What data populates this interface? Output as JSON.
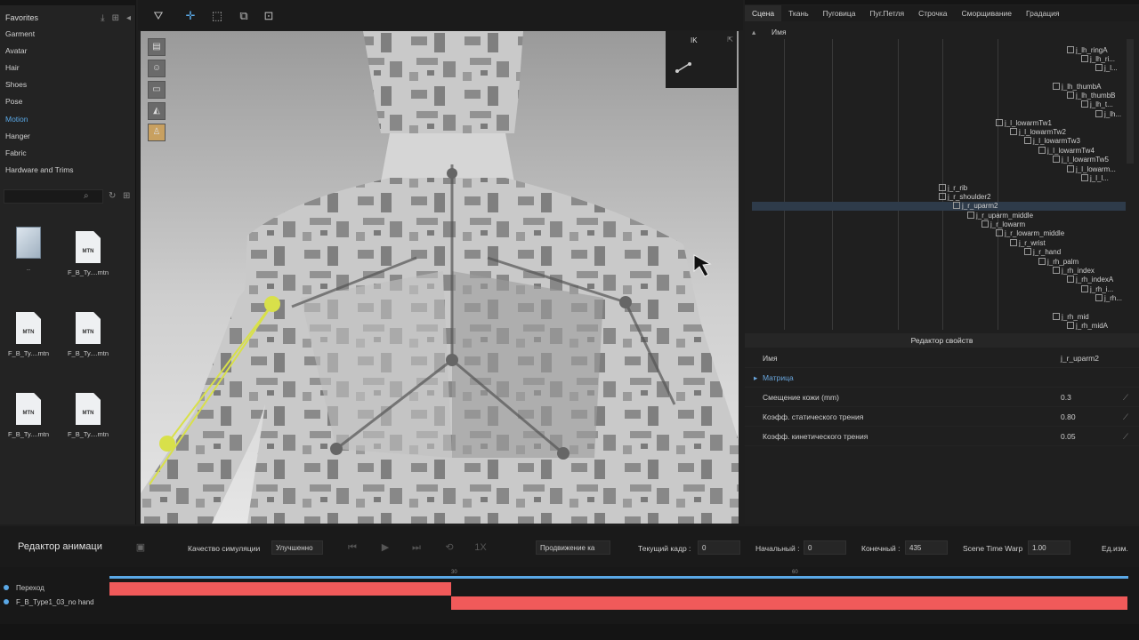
{
  "library": {
    "header": "Favorites",
    "items": [
      "Garment",
      "Avatar",
      "Hair",
      "Shoes",
      "Pose",
      "Motion",
      "Hanger",
      "Fabric",
      "Hardware and Trims"
    ],
    "active_item": "Motion",
    "files": [
      {
        "name": "..",
        "kind": "folder",
        "badge": ""
      },
      {
        "name": "F_B_Ty....mtn",
        "kind": "file",
        "badge": "MTN"
      },
      {
        "name": "F_B_Ty....mtn",
        "kind": "file",
        "badge": "MTN"
      },
      {
        "name": "F_B_Ty....mtn",
        "kind": "file",
        "badge": "MTN"
      },
      {
        "name": "F_B_Ty....mtn",
        "kind": "file",
        "badge": "MTN"
      },
      {
        "name": "F_B_Ty....mtn",
        "kind": "file",
        "badge": "MTN"
      }
    ]
  },
  "viewport": {
    "ik_label": "IK"
  },
  "right": {
    "tabs": [
      "Сцена",
      "Ткань",
      "Пуговица",
      "Пуг.Петля",
      "Строчка",
      "Сморщивание",
      "Градация"
    ],
    "active_tab": "Сцена",
    "tree_header": "Имя",
    "tree_nodes": [
      "j_lh_ringA",
      "j_lh_ri...",
      "j_l...",
      "j_lh_thumbA",
      "j_lh_thumbB",
      "j_lh_t...",
      "j_lh...",
      "j_l_lowarmTw1",
      "j_l_lowarmTw2",
      "j_l_lowarmTw3",
      "j_l_lowarmTw4",
      "j_l_lowarmTw5",
      "j_l_lowarm...",
      "j_l_l...",
      "j_r_rib",
      "j_r_shoulder2",
      "j_r_uparm2",
      "j_r_uparm_middle",
      "j_r_lowarm",
      "j_r_lowarm_middle",
      "j_r_wrist",
      "j_r_hand",
      "j_rh_palm",
      "j_rh_index",
      "j_rh_indexA",
      "j_rh_i...",
      "j_rh...",
      "j_rh_mid",
      "j_rh_midA"
    ],
    "prop_header": "Редактор свойств",
    "props": [
      {
        "label": "Имя",
        "value": "j_r_uparm2"
      },
      {
        "label": "Матрица",
        "value": ""
      },
      {
        "label": "Смещение кожи (mm)",
        "value": "0.3"
      },
      {
        "label": "Коэфф. статического трения",
        "value": "0.80"
      },
      {
        "label": "Коэфф. кинетического трения",
        "value": "0.05"
      }
    ]
  },
  "anim": {
    "title": "Редактор анимаци",
    "quality_label": "Качество симуляции",
    "quality_value": "Улучшенно",
    "progress_value": "Продвижение ка",
    "current_frame_label": "Текущий кадр :",
    "current_frame": "0",
    "start_label": "Начальный :",
    "start_frame": "0",
    "end_label": "Конечный :",
    "end_frame": "435",
    "warp_label": "Scene Time Warp",
    "warp_value": "1.00",
    "unit_label": "Ед.изм.",
    "ruler_ticks": [
      "30",
      "60"
    ],
    "tracks": [
      "Переход",
      "F_B_Type1_03_no hand"
    ],
    "clip_color": "#f05a5a",
    "accent_color": "#5aa8e6"
  }
}
